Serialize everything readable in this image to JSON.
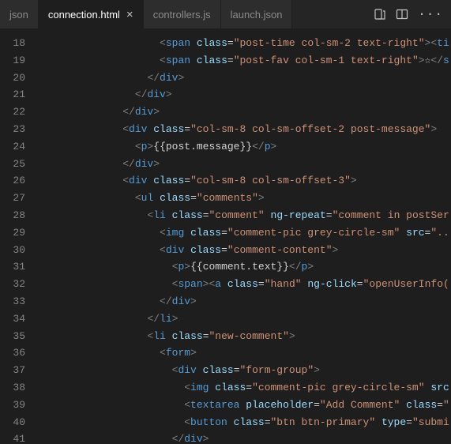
{
  "tabs": {
    "t0": "json",
    "t1": "connection.html",
    "t2": "controllers.js",
    "t3": "launch.json"
  },
  "lineStart": 18,
  "lineEnd": 41,
  "code": {
    "l18": {
      "indent": 10,
      "tokens": [
        [
          "p",
          "<"
        ],
        [
          "tg",
          "span"
        ],
        [
          "p",
          " "
        ],
        [
          "at",
          "class"
        ],
        [
          "eq",
          "="
        ],
        [
          "st",
          "\"post-time col-sm-2 text-right\""
        ],
        [
          "p",
          "><"
        ],
        [
          "tg",
          "ti"
        ]
      ]
    },
    "l19": {
      "indent": 10,
      "tokens": [
        [
          "p",
          "<"
        ],
        [
          "tg",
          "span"
        ],
        [
          "p",
          " "
        ],
        [
          "at",
          "class"
        ],
        [
          "eq",
          "="
        ],
        [
          "st",
          "\"post-fav col-sm-1 text-right\""
        ],
        [
          "p",
          ">"
        ],
        [
          "tx",
          "☆"
        ],
        [
          "p",
          "</"
        ],
        [
          "tg",
          "s"
        ]
      ]
    },
    "l20": {
      "indent": 9,
      "tokens": [
        [
          "p",
          "</"
        ],
        [
          "tg",
          "div"
        ],
        [
          "p",
          ">"
        ]
      ]
    },
    "l21": {
      "indent": 8,
      "tokens": [
        [
          "p",
          "</"
        ],
        [
          "tg",
          "div"
        ],
        [
          "p",
          ">"
        ]
      ]
    },
    "l22": {
      "indent": 7,
      "tokens": [
        [
          "p",
          "</"
        ],
        [
          "tg",
          "div"
        ],
        [
          "p",
          ">"
        ]
      ]
    },
    "l23": {
      "indent": 7,
      "tokens": [
        [
          "p",
          "<"
        ],
        [
          "tg",
          "div"
        ],
        [
          "p",
          " "
        ],
        [
          "at",
          "class"
        ],
        [
          "eq",
          "="
        ],
        [
          "st",
          "\"col-sm-8 col-sm-offset-2 post-message\""
        ],
        [
          "p",
          ">"
        ]
      ]
    },
    "l24": {
      "indent": 8,
      "tokens": [
        [
          "p",
          "<"
        ],
        [
          "tg",
          "p"
        ],
        [
          "p",
          ">"
        ],
        [
          "tx",
          "{{post.message}}"
        ],
        [
          "p",
          "</"
        ],
        [
          "tg",
          "p"
        ],
        [
          "p",
          ">"
        ]
      ]
    },
    "l25": {
      "indent": 7,
      "tokens": [
        [
          "p",
          "</"
        ],
        [
          "tg",
          "div"
        ],
        [
          "p",
          ">"
        ]
      ]
    },
    "l26": {
      "indent": 7,
      "tokens": [
        [
          "p",
          "<"
        ],
        [
          "tg",
          "div"
        ],
        [
          "p",
          " "
        ],
        [
          "at",
          "class"
        ],
        [
          "eq",
          "="
        ],
        [
          "st",
          "\"col-sm-8 col-sm-offset-3\""
        ],
        [
          "p",
          ">"
        ]
      ]
    },
    "l27": {
      "indent": 8,
      "tokens": [
        [
          "p",
          "<"
        ],
        [
          "tg",
          "ul"
        ],
        [
          "p",
          " "
        ],
        [
          "at",
          "class"
        ],
        [
          "eq",
          "="
        ],
        [
          "st",
          "\"comments\""
        ],
        [
          "p",
          ">"
        ]
      ]
    },
    "l28": {
      "indent": 9,
      "tokens": [
        [
          "p",
          "<"
        ],
        [
          "tg",
          "li"
        ],
        [
          "p",
          " "
        ],
        [
          "at",
          "class"
        ],
        [
          "eq",
          "="
        ],
        [
          "st",
          "\"comment\""
        ],
        [
          "p",
          " "
        ],
        [
          "at",
          "ng-repeat"
        ],
        [
          "eq",
          "="
        ],
        [
          "st",
          "\"comment in postSer"
        ]
      ]
    },
    "l29": {
      "indent": 10,
      "tokens": [
        [
          "p",
          "<"
        ],
        [
          "tg",
          "img"
        ],
        [
          "p",
          " "
        ],
        [
          "at",
          "class"
        ],
        [
          "eq",
          "="
        ],
        [
          "st",
          "\"comment-pic grey-circle-sm\""
        ],
        [
          "p",
          " "
        ],
        [
          "at",
          "src"
        ],
        [
          "eq",
          "="
        ],
        [
          "st",
          "\"..."
        ]
      ]
    },
    "l30": {
      "indent": 10,
      "tokens": [
        [
          "p",
          "<"
        ],
        [
          "tg",
          "div"
        ],
        [
          "p",
          " "
        ],
        [
          "at",
          "class"
        ],
        [
          "eq",
          "="
        ],
        [
          "st",
          "\"comment-content\""
        ],
        [
          "p",
          ">"
        ]
      ]
    },
    "l31": {
      "indent": 11,
      "tokens": [
        [
          "p",
          "<"
        ],
        [
          "tg",
          "p"
        ],
        [
          "p",
          ">"
        ],
        [
          "tx",
          "{{comment.text}}"
        ],
        [
          "p",
          "</"
        ],
        [
          "tg",
          "p"
        ],
        [
          "p",
          ">"
        ]
      ]
    },
    "l32": {
      "indent": 11,
      "tokens": [
        [
          "p",
          "<"
        ],
        [
          "tg",
          "span"
        ],
        [
          "p",
          "><"
        ],
        [
          "tg",
          "a"
        ],
        [
          "p",
          " "
        ],
        [
          "at",
          "class"
        ],
        [
          "eq",
          "="
        ],
        [
          "st",
          "\"hand\""
        ],
        [
          "p",
          " "
        ],
        [
          "at",
          "ng-click"
        ],
        [
          "eq",
          "="
        ],
        [
          "st",
          "\"openUserInfo("
        ]
      ]
    },
    "l33": {
      "indent": 10,
      "tokens": [
        [
          "p",
          "</"
        ],
        [
          "tg",
          "div"
        ],
        [
          "p",
          ">"
        ]
      ]
    },
    "l34": {
      "indent": 9,
      "tokens": [
        [
          "p",
          "</"
        ],
        [
          "tg",
          "li"
        ],
        [
          "p",
          ">"
        ]
      ]
    },
    "l35": {
      "indent": 9,
      "tokens": [
        [
          "p",
          "<"
        ],
        [
          "tg",
          "li"
        ],
        [
          "p",
          " "
        ],
        [
          "at",
          "class"
        ],
        [
          "eq",
          "="
        ],
        [
          "st",
          "\"new-comment\""
        ],
        [
          "p",
          ">"
        ]
      ]
    },
    "l36": {
      "indent": 10,
      "tokens": [
        [
          "p",
          "<"
        ],
        [
          "tg",
          "form"
        ],
        [
          "p",
          ">"
        ]
      ]
    },
    "l37": {
      "indent": 11,
      "tokens": [
        [
          "p",
          "<"
        ],
        [
          "tg",
          "div"
        ],
        [
          "p",
          " "
        ],
        [
          "at",
          "class"
        ],
        [
          "eq",
          "="
        ],
        [
          "st",
          "\"form-group\""
        ],
        [
          "p",
          ">"
        ]
      ]
    },
    "l38": {
      "indent": 12,
      "tokens": [
        [
          "p",
          "<"
        ],
        [
          "tg",
          "img"
        ],
        [
          "p",
          " "
        ],
        [
          "at",
          "class"
        ],
        [
          "eq",
          "="
        ],
        [
          "st",
          "\"comment-pic grey-circle-sm\""
        ],
        [
          "p",
          " "
        ],
        [
          "at",
          "src"
        ]
      ]
    },
    "l39": {
      "indent": 12,
      "tokens": [
        [
          "p",
          "<"
        ],
        [
          "tg",
          "textarea"
        ],
        [
          "p",
          " "
        ],
        [
          "at",
          "placeholder"
        ],
        [
          "eq",
          "="
        ],
        [
          "st",
          "\"Add Comment\""
        ],
        [
          "p",
          " "
        ],
        [
          "at",
          "class"
        ],
        [
          "eq",
          "="
        ],
        [
          "st",
          "\""
        ]
      ]
    },
    "l40": {
      "indent": 12,
      "tokens": [
        [
          "p",
          "<"
        ],
        [
          "tg",
          "button"
        ],
        [
          "p",
          " "
        ],
        [
          "at",
          "class"
        ],
        [
          "eq",
          "="
        ],
        [
          "st",
          "\"btn btn-primary\""
        ],
        [
          "p",
          " "
        ],
        [
          "at",
          "type"
        ],
        [
          "eq",
          "="
        ],
        [
          "st",
          "\"submi"
        ]
      ]
    },
    "l41": {
      "indent": 11,
      "tokens": [
        [
          "p",
          "</"
        ],
        [
          "tg",
          "div"
        ],
        [
          "p",
          ">"
        ]
      ]
    }
  }
}
